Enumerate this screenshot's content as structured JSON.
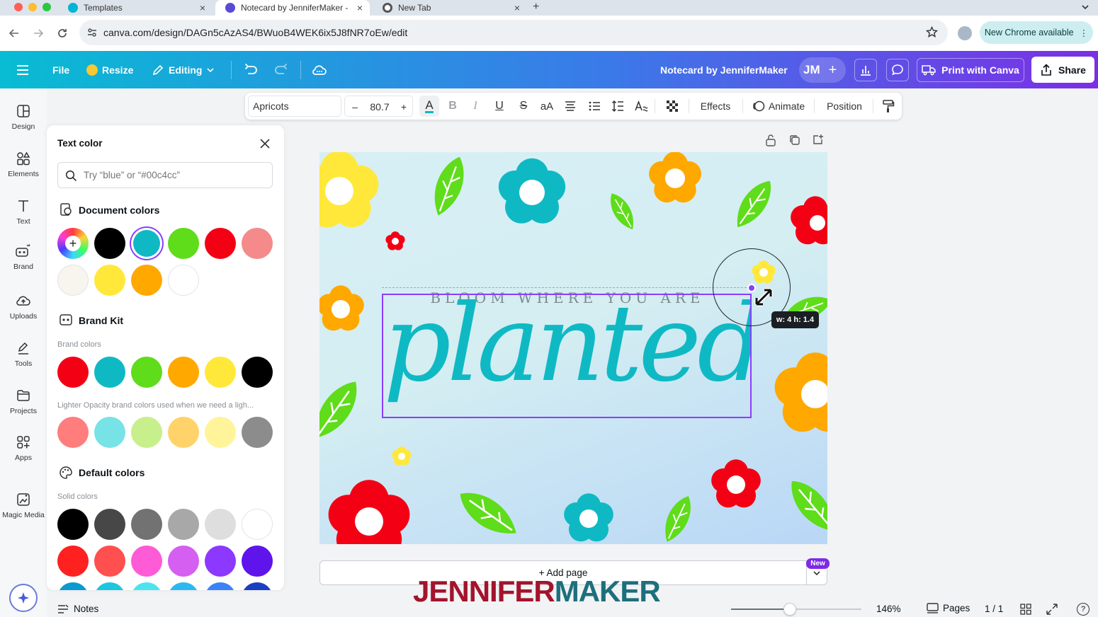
{
  "browser": {
    "tabs": [
      {
        "title": "Templates",
        "close": "×"
      },
      {
        "title": "Notecard by JenniferMaker -",
        "close": "×"
      },
      {
        "title": "New Tab",
        "close": "×"
      }
    ],
    "new_tab": "+",
    "url": "canva.com/design/DAGn5cAzAS4/BWuoB4WEK6ix5J8fNR7oEw/edit",
    "chrome_update": "New Chrome available"
  },
  "header": {
    "file": "File",
    "resize": "Resize",
    "editing": "Editing",
    "design_title": "Notecard by JenniferMaker",
    "avatar": "JM",
    "print": "Print with Canva",
    "share": "Share",
    "gradient_start": "#08bcd3",
    "gradient_end": "#7b2fe5"
  },
  "rail": [
    {
      "label": "Design",
      "icon": "layout-icon"
    },
    {
      "label": "Elements",
      "icon": "shapes-icon"
    },
    {
      "label": "Text",
      "icon": "text-icon"
    },
    {
      "label": "Brand",
      "icon": "brand-icon"
    },
    {
      "label": "Uploads",
      "icon": "cloud-upload-icon"
    },
    {
      "label": "Tools",
      "icon": "pen-icon"
    },
    {
      "label": "Projects",
      "icon": "folder-icon"
    },
    {
      "label": "Apps",
      "icon": "apps-icon"
    },
    {
      "label": "Magic Media",
      "icon": "magic-media-icon"
    }
  ],
  "panel": {
    "title": "Text color",
    "search_placeholder": "Try “blue” or “#00c4cc”",
    "document_colors_title": "Document colors",
    "document_colors": [
      "#000000",
      "#0fb9c4",
      "#5fdc1a",
      "#f40014",
      "#f48a8a",
      "#f8f5ef",
      "#ffe83a",
      "#ffa800",
      "#ffffff"
    ],
    "brand_kit_title": "Brand Kit",
    "brand_colors_label": "Brand colors",
    "brand_colors": [
      "#f40014",
      "#0fb9c4",
      "#5fdc1a",
      "#ffa800",
      "#ffe83a",
      "#000000"
    ],
    "lighter_label": "Lighter Opacity brand colors used when we need a ligh...",
    "lighter_colors": [
      "#ff7d7d",
      "#78e3e6",
      "#c7ef8c",
      "#ffd36a",
      "#fff49a",
      "#8c8c8c"
    ],
    "default_colors_title": "Default colors",
    "solid_colors_label": "Solid colors",
    "solid_row1": [
      "#000000",
      "#474747",
      "#727272",
      "#a8a8a8",
      "#dedede",
      "#ffffff"
    ],
    "solid_row2": [
      "#ff2020",
      "#ff4f4f",
      "#ff5bd6",
      "#d55ff0",
      "#8c38ff",
      "#5f14ec"
    ],
    "solid_row3": [
      "#0a9ad0",
      "#1ac6e0",
      "#4ce3f0",
      "#2bb8f0",
      "#3b82f6",
      "#1a3fbf"
    ]
  },
  "toolbar": {
    "font": "Apricots",
    "minus": "–",
    "size": "80.7",
    "plus": "+",
    "bold": "B",
    "italic": "I",
    "underline": "U",
    "strike": "S",
    "case": "aA",
    "effects": "Effects",
    "animate": "Animate",
    "position": "Position"
  },
  "design": {
    "top_text": "BLOOM WHERE YOU ARE",
    "main_text": "planted",
    "text_color": "#0fb9c4",
    "resize_tooltip": "w: 4 h: 1.4"
  },
  "add_page": {
    "label": "+ Add page",
    "badge": "New"
  },
  "watermark": {
    "part1": "JENNIFER",
    "part2": "MAKER"
  },
  "footer": {
    "notes": "Notes",
    "zoom": "146%",
    "zoom_level": 0.45,
    "pages_label": "Pages",
    "page_count": "1 / 1",
    "help": "?"
  }
}
